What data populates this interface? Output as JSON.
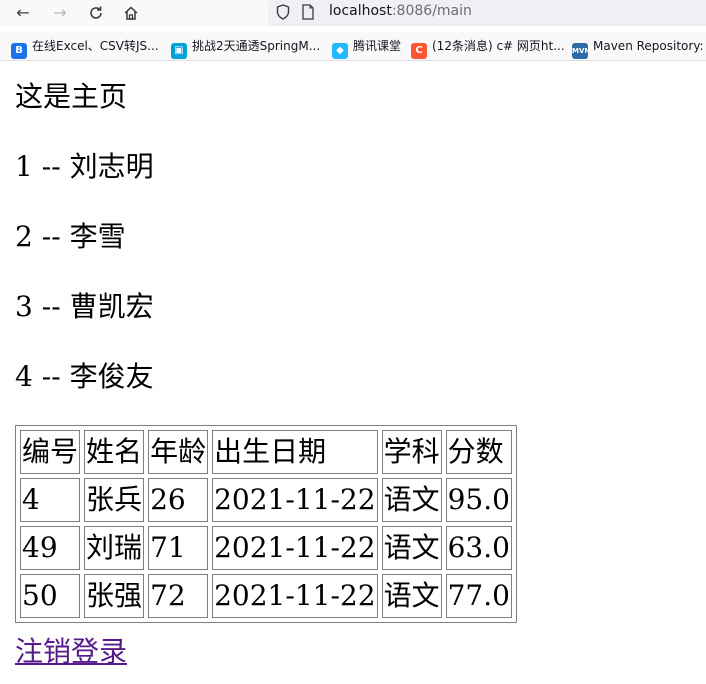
{
  "browser": {
    "url_host": "localhost",
    "url_path": ":8086/main",
    "bookmarks": [
      {
        "label": "在线Excel、CSV转JS...",
        "icon": "bj-bookmark-icon",
        "color": "#1a73e8"
      },
      {
        "label": "挑战2天通透SpringM...",
        "icon": "bilibili-icon",
        "color": "#00a1d6"
      },
      {
        "label": "腾讯课堂",
        "icon": "tencent-classroom-icon",
        "color": "#23b8ff"
      },
      {
        "label": "(12条消息) c# 网页ht...",
        "icon": "csdn-icon",
        "color": "#fc5531"
      },
      {
        "label": "Maven Repository:",
        "icon": "mvn-icon",
        "color": "#2d6ca8"
      }
    ]
  },
  "page": {
    "title": "这是主页",
    "users": [
      {
        "id": "1",
        "sep": " -- ",
        "name": "刘志明"
      },
      {
        "id": "2",
        "sep": " -- ",
        "name": "李雪"
      },
      {
        "id": "3",
        "sep": " -- ",
        "name": "曹凯宏"
      },
      {
        "id": "4",
        "sep": " -- ",
        "name": "李俊友"
      }
    ],
    "table": {
      "headers": [
        "编号",
        "姓名",
        "年龄",
        "出生日期",
        "学科",
        "分数"
      ],
      "rows": [
        [
          "4",
          "张兵",
          "26",
          "2021-11-22",
          "语文",
          "95.0"
        ],
        [
          "49",
          "刘瑞",
          "71",
          "2021-11-22",
          "语文",
          "63.0"
        ],
        [
          "50",
          "张强",
          "72",
          "2021-11-22",
          "语文",
          "77.0"
        ]
      ]
    },
    "logout_label": "注销登录"
  }
}
